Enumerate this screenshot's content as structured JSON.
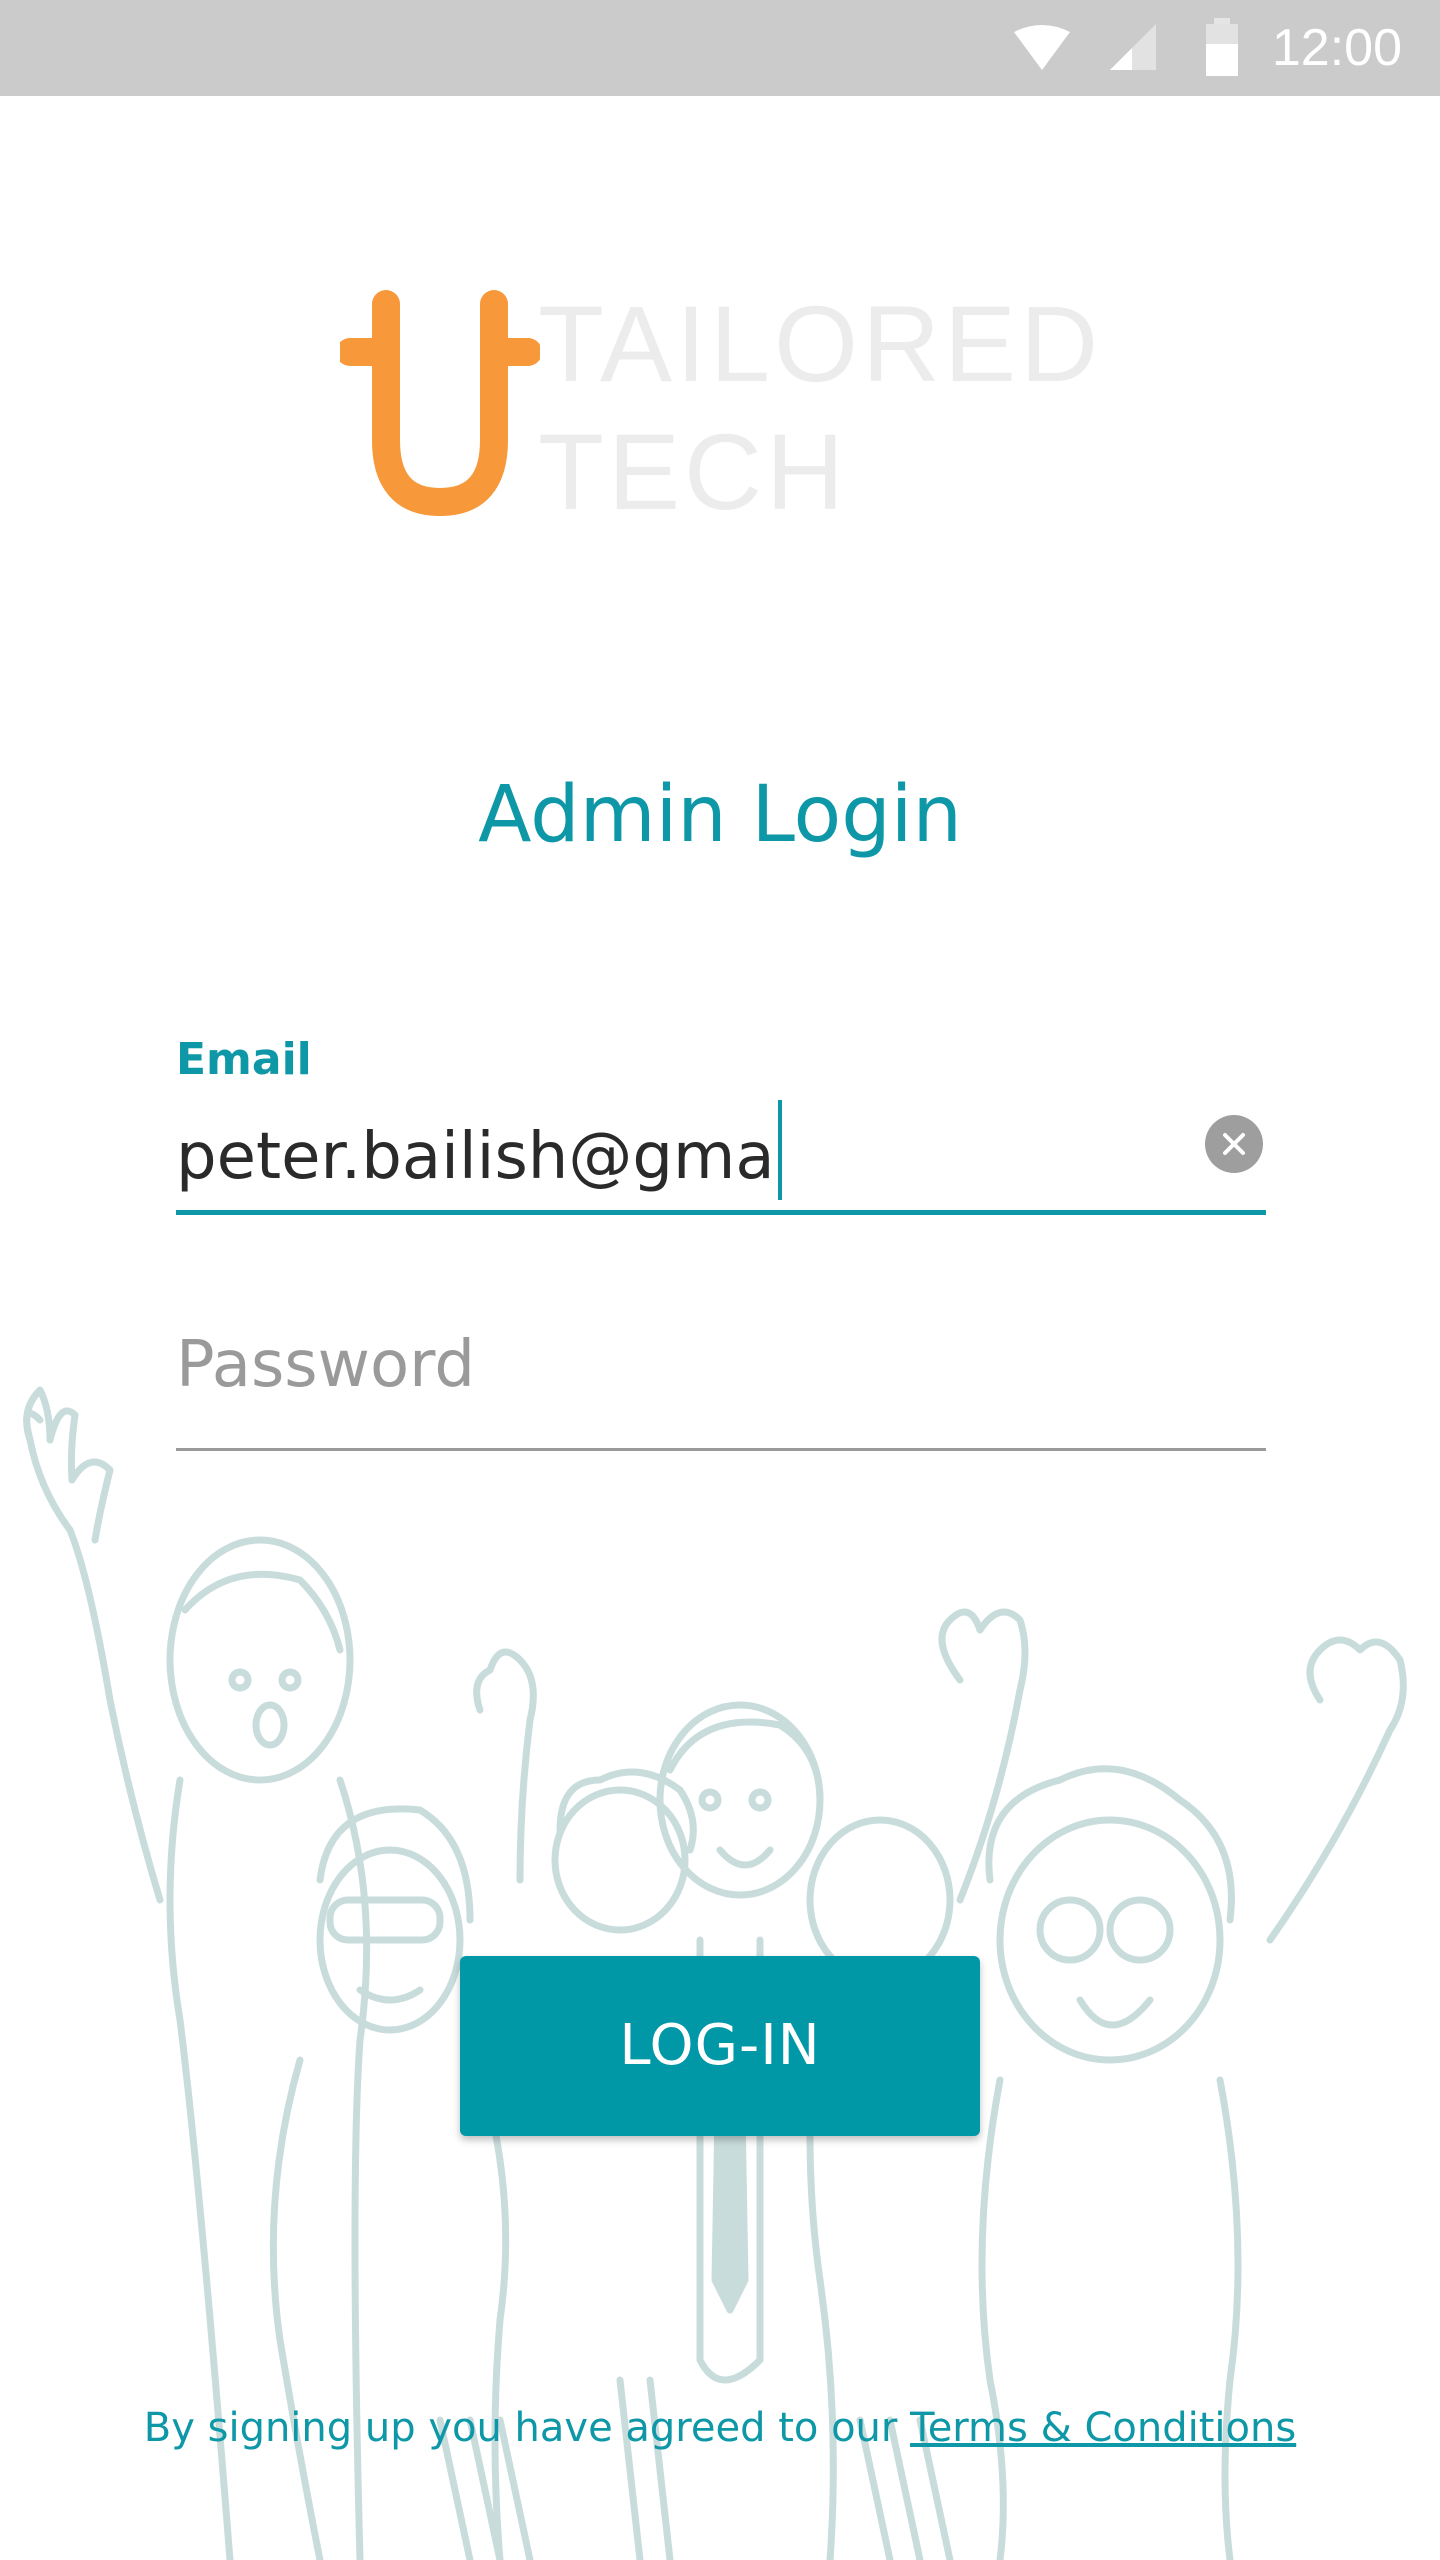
{
  "status_bar": {
    "time": "12:00",
    "icons": [
      "wifi-icon",
      "cell-signal-icon",
      "battery-icon"
    ]
  },
  "logo": {
    "mark": "orange-t-logo-mark",
    "line1": "TAILORED",
    "line2": "TECH",
    "mark_color": "#f7993a",
    "text_color": "#ececec"
  },
  "page": {
    "title": "Admin Login"
  },
  "form": {
    "email_label": "Email",
    "email_value": "peter.bailish@gma",
    "clear_icon": "clear-icon",
    "password_placeholder": "Password",
    "login_label": "LOG-IN"
  },
  "footer": {
    "prefix": "By signing up you have agreed to our ",
    "terms_link": "Terms & Conditions"
  },
  "colors": {
    "accent": "#0d97a7",
    "button": "#0097a6",
    "illustration": "#c9dcdc"
  }
}
